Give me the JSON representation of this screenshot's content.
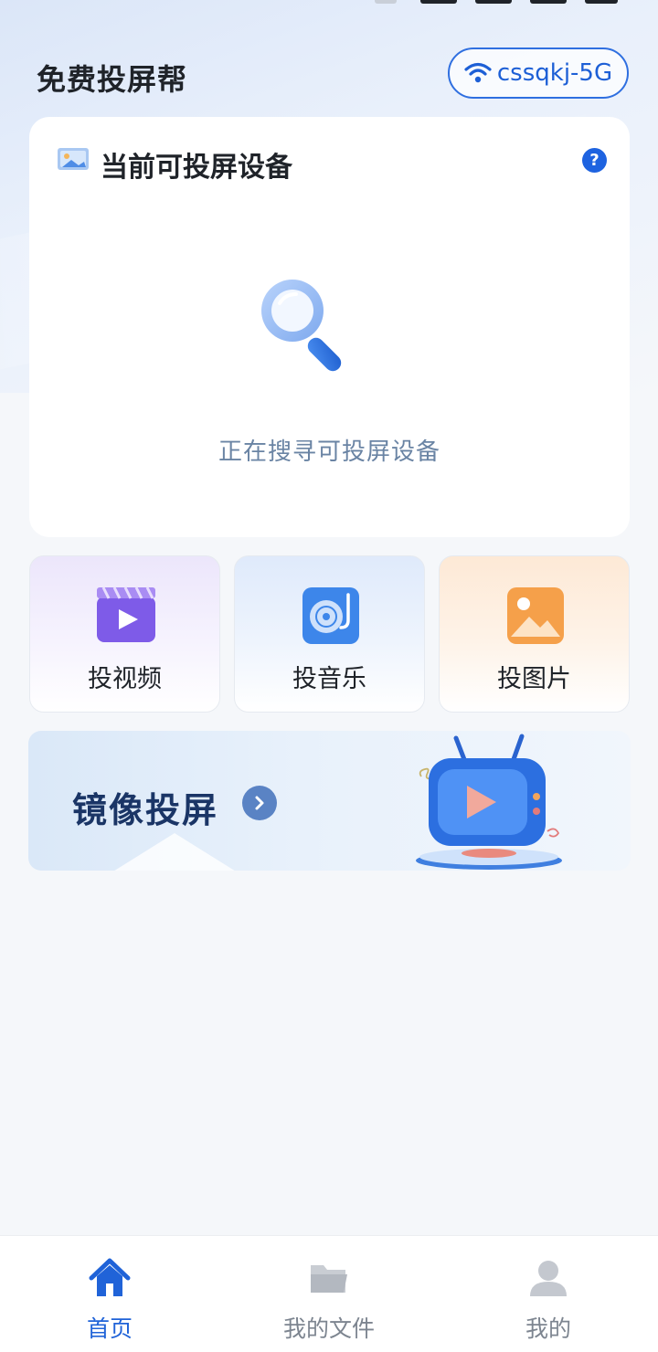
{
  "app": {
    "title": "免费投屏帮",
    "wifi_name": "cssqkj-5G"
  },
  "device_card": {
    "title": "当前可投屏设备",
    "help_icon": "question-circle-icon",
    "status_text": "正在搜寻可投屏设备"
  },
  "features": [
    {
      "label": "投视频",
      "icon": "video-clapper-icon"
    },
    {
      "label": "投音乐",
      "icon": "music-disc-icon"
    },
    {
      "label": "投图片",
      "icon": "image-icon"
    }
  ],
  "mirror": {
    "label": "镜像投屏",
    "arrow_icon": "chevron-right-icon"
  },
  "bottom_nav": {
    "items": [
      {
        "label": "首页",
        "icon": "home-icon",
        "active": true
      },
      {
        "label": "我的文件",
        "icon": "folder-icon",
        "active": false
      },
      {
        "label": "我的",
        "icon": "user-icon",
        "active": false
      }
    ]
  },
  "colors": {
    "accent": "#2063d8",
    "background": "#f5f7fa",
    "card": "#ffffff",
    "inactive": "#7d8590"
  }
}
